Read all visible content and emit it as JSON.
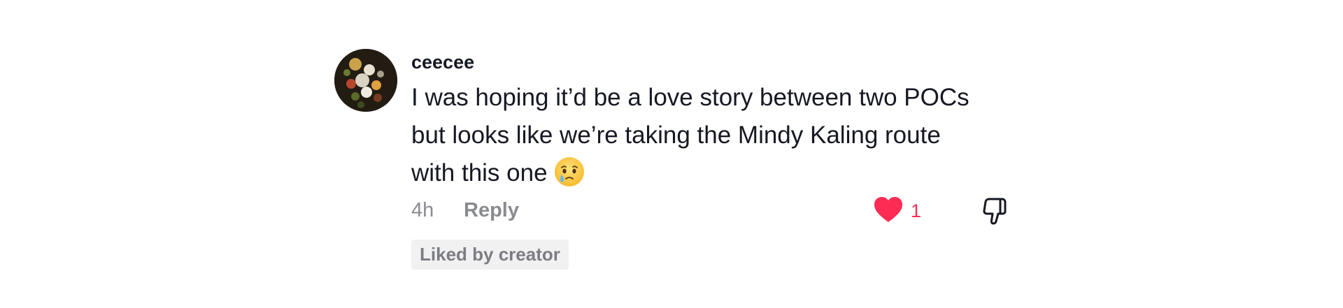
{
  "comment": {
    "username": "ceecee",
    "text": "I was hoping it’d be a love story between two POCs but looks like we’re taking the Mindy Kaling route with this one",
    "emoji": "holding-back-tears-emoji",
    "time": "4h",
    "reply_label": "Reply",
    "like_count": "1",
    "liked_by_creator_label": "Liked by creator"
  },
  "colors": {
    "like_red": "#fe2c55",
    "text_primary": "#161823",
    "text_secondary": "#8a8b91",
    "badge_bg": "#f1f1f2"
  },
  "icons": {
    "like": "heart-icon",
    "dislike": "thumbs-down-icon"
  }
}
